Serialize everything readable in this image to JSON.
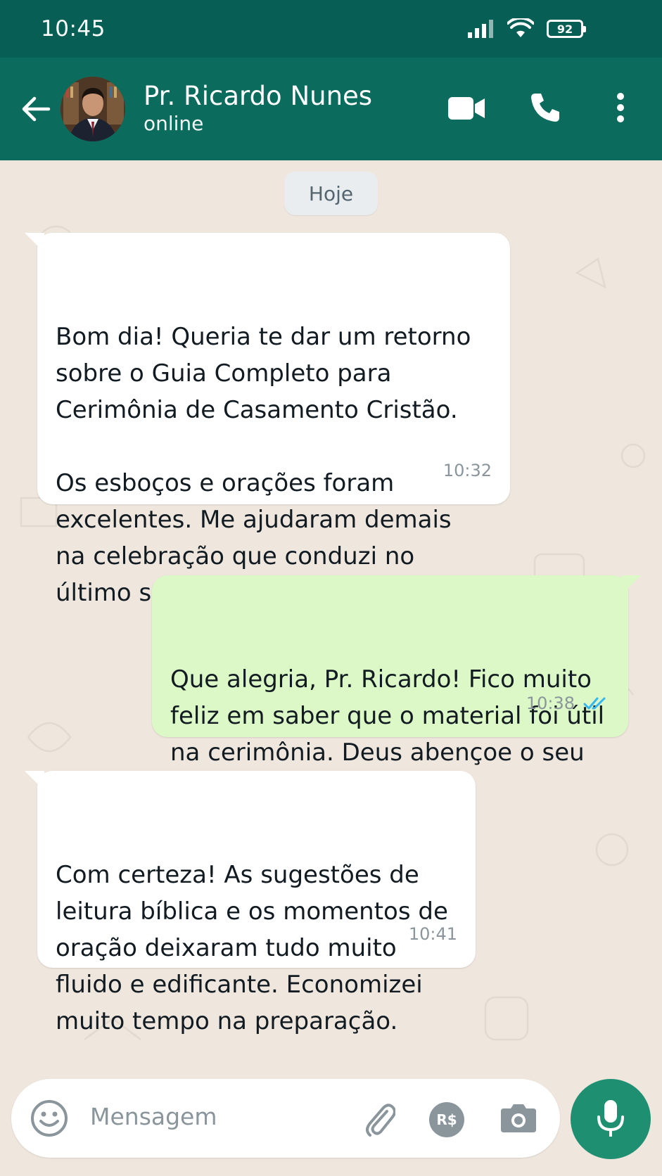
{
  "status_bar": {
    "time": "10:45",
    "battery": "92",
    "icons": [
      "signal-icon",
      "wifi-icon",
      "battery-icon"
    ]
  },
  "header": {
    "contact_name": "Pr. Ricardo Nunes",
    "presence": "online",
    "icons": [
      "back-arrow-icon",
      "video-call-icon",
      "phone-icon",
      "more-vertical-icon"
    ]
  },
  "chat": {
    "date_separator": "Hoje",
    "messages": [
      {
        "direction": "incoming",
        "text": "Bom dia! Queria te dar um retorno\nsobre o Guia Completo para\nCerimônia de Casamento Cristão.\n\nOs esboços e orações foram\nexcelentes. Me ajudaram demais\nna celebração que conduzi no\núltimo sábado. 🙏",
        "time": "10:32"
      },
      {
        "direction": "outgoing",
        "text": "Que alegria, Pr. Ricardo! Fico muito\nfeliz em saber que o material foi útil\nna cerimônia. Deus abençoe o seu\nministério e o casal!",
        "time": "10:38",
        "status_icon": "double-check-icon"
      },
      {
        "direction": "incoming",
        "text": "Com certeza! As sugestões de\nleitura bíblica e os momentos de\noração deixaram tudo muito\nfluido e edificante. Economizei\nmuito tempo na preparação.",
        "time": "10:41"
      }
    ]
  },
  "input_bar": {
    "placeholder": "Mensagem",
    "payment_label": "R$",
    "icons": [
      "emoji-icon",
      "attach-icon",
      "payment-icon",
      "camera-icon",
      "microphone-icon"
    ]
  },
  "colors": {
    "header_bg": "#0b6b5d",
    "statusbar_bg": "#075e54",
    "chat_bg": "#efe7de",
    "incoming_bubble": "#ffffff",
    "outgoing_bubble": "#dcf8c6",
    "read_check": "#34b7f1",
    "mic_button": "#1f8f72"
  }
}
